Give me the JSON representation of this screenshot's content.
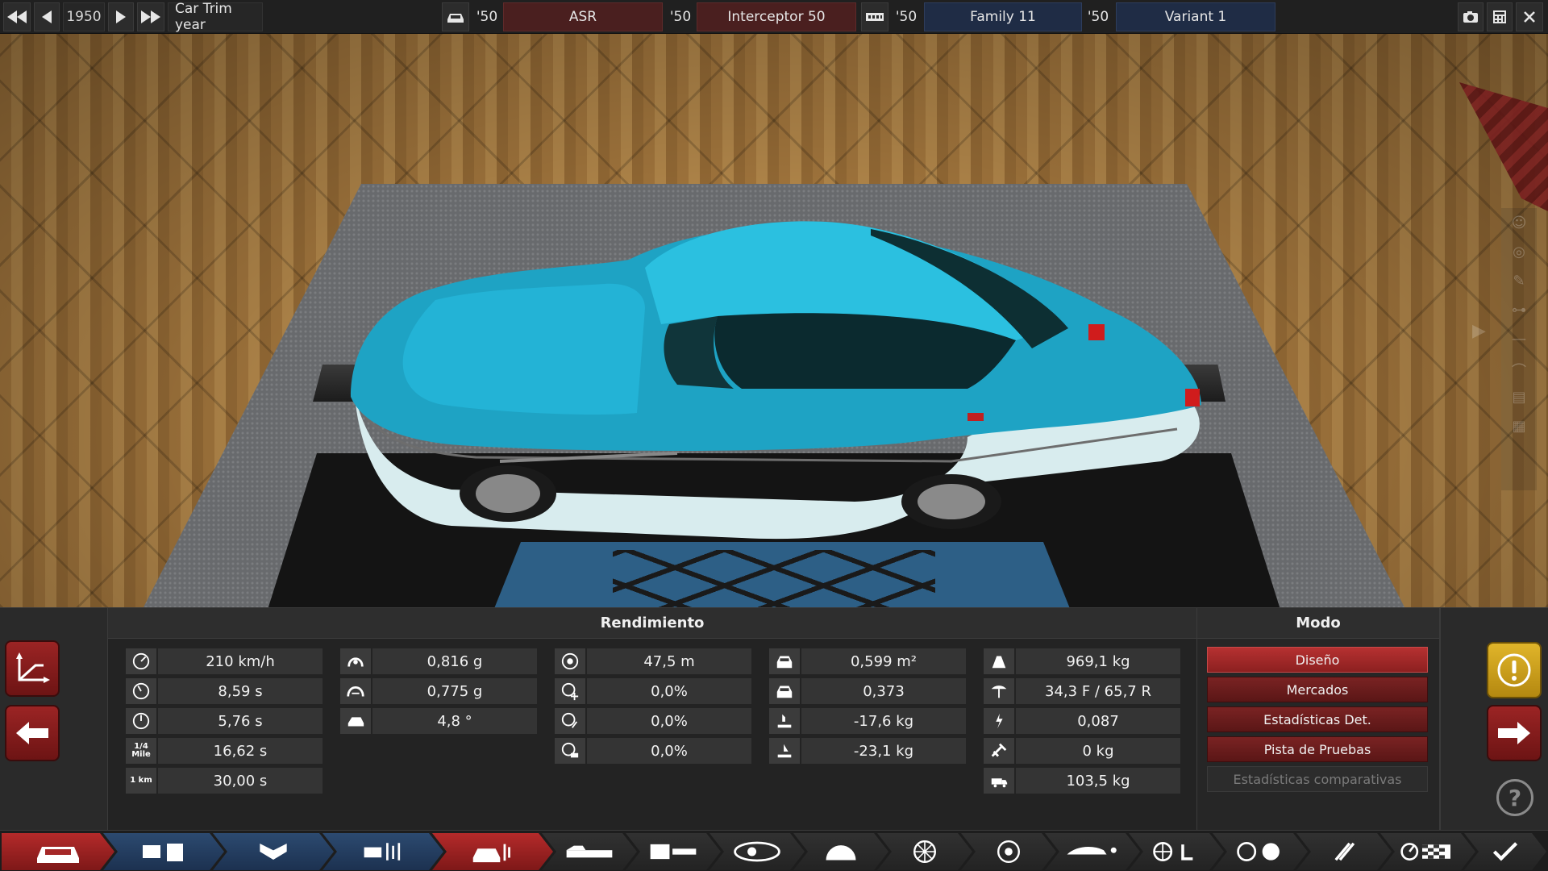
{
  "topbar": {
    "year": "1950",
    "trim_label": "Car Trim year",
    "model": {
      "year": "'50",
      "name": "ASR"
    },
    "engine": {
      "year": "'50",
      "name": "Interceptor 50"
    },
    "family": {
      "year": "'50",
      "name": "Family 11"
    },
    "variant": {
      "year": "'50",
      "name": "Variant 1"
    }
  },
  "performance": {
    "title": "Rendimiento",
    "col1": [
      {
        "icon": "top-speed-icon",
        "value": "210 km/h"
      },
      {
        "icon": "acceleration-100-icon",
        "value": "8,59 s"
      },
      {
        "icon": "acceleration-80-icon",
        "value": "5,76 s"
      },
      {
        "icon": "quarter-mile-icon",
        "value": "16,62 s",
        "icon_text": "1/4 Mile"
      },
      {
        "icon": "one-km-icon",
        "value": "30,00 s",
        "icon_text": "1 km"
      }
    ],
    "col2": [
      {
        "icon": "cornering-low-speed-icon",
        "value": "0,816 g"
      },
      {
        "icon": "cornering-high-speed-icon",
        "value": "0,775 g"
      },
      {
        "icon": "body-roll-icon",
        "value": "4,8 °"
      }
    ],
    "col3": [
      {
        "icon": "braking-distance-icon",
        "value": "47,5 m"
      },
      {
        "icon": "brake-fade-icon",
        "value": "0,0%"
      },
      {
        "icon": "wheel-slip-icon",
        "value": "0,0%"
      },
      {
        "icon": "brake-lockup-icon",
        "value": "0,0%"
      }
    ],
    "col4": [
      {
        "icon": "frontal-area-icon",
        "value": "0,599 m²"
      },
      {
        "icon": "drag-coefficient-icon",
        "value": "0,373"
      },
      {
        "icon": "front-downforce-icon",
        "value": "-17,6 kg"
      },
      {
        "icon": "rear-downforce-icon",
        "value": "-23,1 kg"
      }
    ],
    "col5": [
      {
        "icon": "weight-icon",
        "value": "969,1 kg"
      },
      {
        "icon": "weight-distribution-icon",
        "value": "34,3 F / 65,7 R"
      },
      {
        "icon": "power-to-weight-icon",
        "value": "0,087"
      },
      {
        "icon": "towing-weight-icon",
        "value": "0 kg"
      },
      {
        "icon": "cargo-capacity-icon",
        "value": "103,5 kg"
      }
    ]
  },
  "mode": {
    "title": "Modo",
    "buttons": [
      "Diseño",
      "Mercados",
      "Estadísticas Det.",
      "Pista de Pruebas",
      "Estadísticas comparativas"
    ]
  },
  "colors": {
    "accent_red": "#a52828",
    "accent_blue": "#1f2c45",
    "gold": "#d4a820",
    "car_body": "#1ea3c4"
  },
  "tabs": [
    "car-model-icon",
    "engine-family-icon",
    "engine-variant-icon",
    "engine-tuning-icon",
    "car-trim-icon",
    "chassis-icon",
    "suspension-icon",
    "body-icon",
    "fixtures-icon",
    "interior-icon",
    "wheels-icon",
    "brakes-icon",
    "aerodynamics-icon",
    "drivetrain-icon",
    "gearbox-icon",
    "exhaust-icon",
    "test-track-icon",
    "finish-check-icon"
  ]
}
